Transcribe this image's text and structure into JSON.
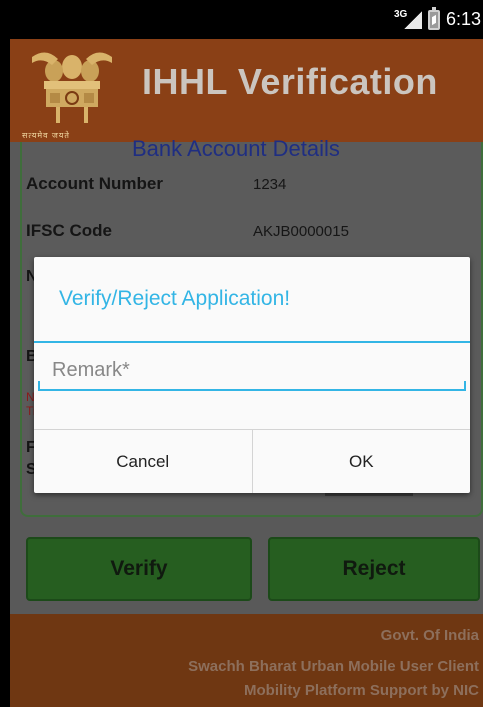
{
  "status_bar": {
    "network": "3G",
    "time": "6:13"
  },
  "header": {
    "title": "IHHL Verification",
    "emblem_motto": "सत्यमेव जयते"
  },
  "details": {
    "section_title": "Bank Account Details",
    "rows": [
      {
        "label": "Account Number",
        "value": "1234"
      },
      {
        "label": "IFSC Code",
        "value": "AKJB0000015"
      }
    ],
    "partial_labels": [
      "N",
      "B",
      "N",
      "Ti",
      "F",
      "S"
    ]
  },
  "actions": {
    "verify_label": "Verify",
    "reject_label": "Reject"
  },
  "footer": {
    "line1": "Govt. Of India",
    "line2": "Swachh Bharat Urban Mobile User Client",
    "line3": "Mobility Platform Support by NIC"
  },
  "dialog": {
    "title": "Verify/Reject Application!",
    "remark_placeholder": "Remark*",
    "remark_value": "",
    "cancel_label": "Cancel",
    "ok_label": "OK"
  },
  "colors": {
    "header_bg": "#8a4016",
    "action_green": "#265e20",
    "dialog_accent": "#33b5e5",
    "overlay_grey": "#595959"
  }
}
